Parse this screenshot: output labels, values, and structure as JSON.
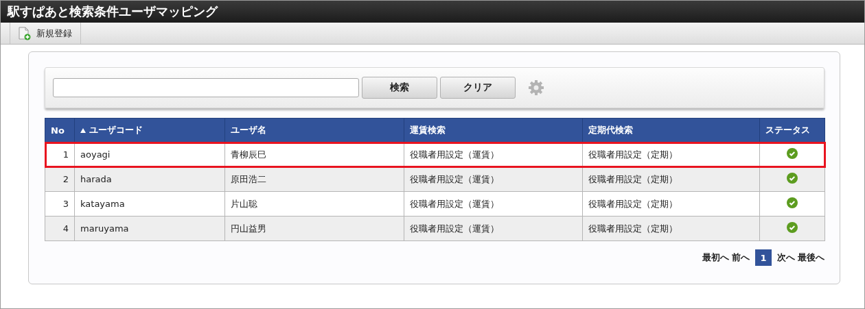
{
  "window": {
    "title": "駅すぱあと検索条件ユーザマッピング"
  },
  "toolbar": [
    {
      "label": "新規登録"
    }
  ],
  "search": {
    "buttons": [
      "検索",
      "クリア"
    ]
  },
  "table": {
    "columns": [
      {
        "label": "No",
        "sorted_ascending": false
      },
      {
        "label": "ユーザコード",
        "sorted_ascending": true
      },
      {
        "label": "ユーザ名",
        "sorted_ascending": false
      },
      {
        "label": "運賃検索",
        "sorted_ascending": false
      },
      {
        "label": "定期代検索",
        "sorted_ascending": false
      },
      {
        "label": "ステータス",
        "sorted_ascending": false
      }
    ],
    "rows": [
      {
        "no": "1",
        "code": "aoyagi",
        "name": "青柳辰巳",
        "fare": "役職者用設定（運賃）",
        "commuter": "役職者用設定（定期）",
        "enabled": true,
        "highlighted": true
      },
      {
        "no": "2",
        "code": "harada",
        "name": "原田浩二",
        "fare": "役職者用設定（運賃）",
        "commuter": "役職者用設定（定期）",
        "enabled": true,
        "highlighted": false
      },
      {
        "no": "3",
        "code": "katayama",
        "name": "片山聡",
        "fare": "役職者用設定（運賃）",
        "commuter": "役職者用設定（定期）",
        "enabled": true,
        "highlighted": false
      },
      {
        "no": "4",
        "code": "maruyama",
        "name": "円山益男",
        "fare": "役職者用設定（運賃）",
        "commuter": "役職者用設定（定期）",
        "enabled": true,
        "highlighted": false
      }
    ]
  },
  "pagination": {
    "first": "最初へ",
    "prev": "前へ",
    "pages": [
      {
        "label": "1",
        "selected": true
      }
    ],
    "next": "次へ",
    "last": "最後へ"
  }
}
